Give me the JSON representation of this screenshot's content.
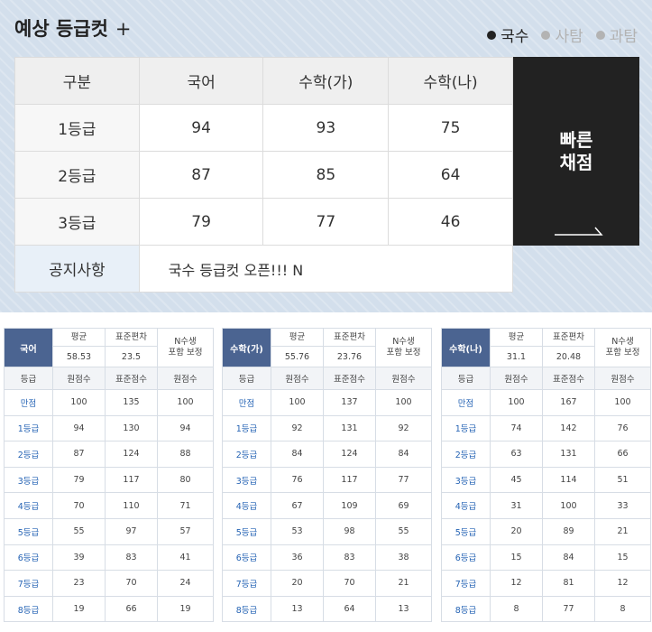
{
  "header": {
    "title": "예상 등급컷",
    "plus": "+",
    "filters": [
      {
        "label": "국수",
        "active": true
      },
      {
        "label": "사탐",
        "active": false
      },
      {
        "label": "과탐",
        "active": false
      }
    ]
  },
  "cut_table": {
    "headers": [
      "구분",
      "국어",
      "수학(가)",
      "수학(나)"
    ],
    "rows": [
      {
        "grade": "1등급",
        "values": [
          "94",
          "93",
          "75"
        ]
      },
      {
        "grade": "2등급",
        "values": [
          "87",
          "85",
          "64"
        ]
      },
      {
        "grade": "3등급",
        "values": [
          "79",
          "77",
          "46"
        ]
      }
    ],
    "notice_label": "공지사항",
    "notice_text": "국수 등급컷 오픈!!! N"
  },
  "quick_button": {
    "line1": "빠른",
    "line2": "채점"
  },
  "stats": [
    {
      "subject": "국어",
      "mean_label": "평균",
      "sd_label": "표준편차",
      "nadj_label": [
        "N수생",
        "포함 보정"
      ],
      "mean": "58.53",
      "sd": "23.5",
      "col_headers": [
        "등급",
        "원점수",
        "표준점수",
        "원점수"
      ],
      "rows": [
        [
          "만점",
          "100",
          "135",
          "100"
        ],
        [
          "1등급",
          "94",
          "130",
          "94"
        ],
        [
          "2등급",
          "87",
          "124",
          "88"
        ],
        [
          "3등급",
          "79",
          "117",
          "80"
        ],
        [
          "4등급",
          "70",
          "110",
          "71"
        ],
        [
          "5등급",
          "55",
          "97",
          "57"
        ],
        [
          "6등급",
          "39",
          "83",
          "41"
        ],
        [
          "7등급",
          "23",
          "70",
          "24"
        ],
        [
          "8등급",
          "19",
          "66",
          "19"
        ]
      ]
    },
    {
      "subject": "수학(가)",
      "mean_label": "평균",
      "sd_label": "표준편차",
      "nadj_label": [
        "N수생",
        "포함 보정"
      ],
      "mean": "55.76",
      "sd": "23.76",
      "col_headers": [
        "등급",
        "원점수",
        "표준점수",
        "원점수"
      ],
      "rows": [
        [
          "만점",
          "100",
          "137",
          "100"
        ],
        [
          "1등급",
          "92",
          "131",
          "92"
        ],
        [
          "2등급",
          "84",
          "124",
          "84"
        ],
        [
          "3등급",
          "76",
          "117",
          "77"
        ],
        [
          "4등급",
          "67",
          "109",
          "69"
        ],
        [
          "5등급",
          "53",
          "98",
          "55"
        ],
        [
          "6등급",
          "36",
          "83",
          "38"
        ],
        [
          "7등급",
          "20",
          "70",
          "21"
        ],
        [
          "8등급",
          "13",
          "64",
          "13"
        ]
      ]
    },
    {
      "subject": "수학(나)",
      "mean_label": "평균",
      "sd_label": "표준편차",
      "nadj_label": [
        "N수생",
        "포함 보정"
      ],
      "mean": "31.1",
      "sd": "20.48",
      "col_headers": [
        "등급",
        "원점수",
        "표준점수",
        "원점수"
      ],
      "rows": [
        [
          "만점",
          "100",
          "167",
          "100"
        ],
        [
          "1등급",
          "74",
          "142",
          "76"
        ],
        [
          "2등급",
          "63",
          "131",
          "66"
        ],
        [
          "3등급",
          "45",
          "114",
          "51"
        ],
        [
          "4등급",
          "31",
          "100",
          "33"
        ],
        [
          "5등급",
          "20",
          "89",
          "21"
        ],
        [
          "6등급",
          "15",
          "84",
          "15"
        ],
        [
          "7등급",
          "12",
          "81",
          "12"
        ],
        [
          "8등급",
          "8",
          "77",
          "8"
        ]
      ]
    }
  ]
}
